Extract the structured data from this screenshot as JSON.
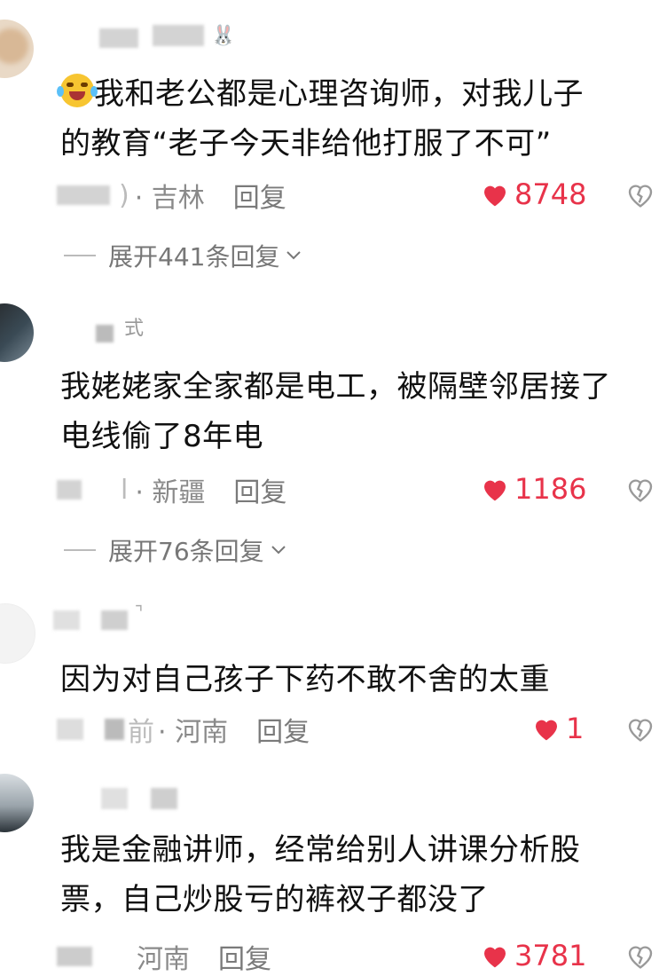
{
  "comments": [
    {
      "emoji": "crying-laughing-emoji",
      "text_line1": "我和老公都是心理咨询师，对我儿子",
      "text_line2": "的教育“老子今天非给他打服了不可”",
      "name_tail": ")",
      "location": "· 吉林",
      "reply": "回复",
      "likes": "8748",
      "expand": "展开441条回复"
    },
    {
      "name_tail": "式",
      "text_line1": "我姥姥家全家都是电工，被隔壁邻居接了",
      "text_line2": "电线偷了8年电",
      "name_tail2": "l",
      "location": "· 新疆",
      "reply": "回复",
      "likes": "1186",
      "expand": "展开76条回复"
    },
    {
      "text_line1": "因为对自己孩子下药不敢不舍的太重",
      "name_tail": "前",
      "location": "· 河南",
      "reply": "回复",
      "likes": "1"
    },
    {
      "text_line1": "我是金融讲师，经常给别人讲课分析股",
      "text_line2": "票，自己炒股亏的裤衩子都没了",
      "location": "河南",
      "reply": "回复",
      "likes": "3781"
    }
  ],
  "colors": {
    "like_red": "#e8334a",
    "meta_gray": "#8a8a8a"
  }
}
